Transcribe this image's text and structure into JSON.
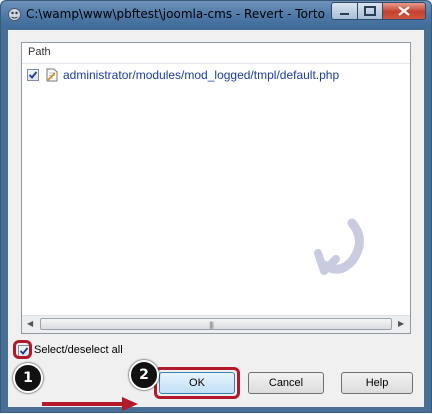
{
  "window": {
    "title": "C:\\wamp\\www\\pbftest\\joomla-cms - Revert - TortoiseSVN"
  },
  "list": {
    "column_header": "Path",
    "rows": [
      {
        "checked": true,
        "path": "administrator/modules/mod_logged/tmpl/default.php",
        "icon": "modified-file-icon"
      }
    ]
  },
  "select_all": {
    "label": "Select/deselect all",
    "checked": true
  },
  "buttons": {
    "ok": "OK",
    "cancel": "Cancel",
    "help": "Help"
  },
  "annotations": {
    "marker_1": "1",
    "marker_2": "2",
    "highlight_color": "#b21a2b"
  },
  "colors": {
    "path_text": "#1a3e9a",
    "titlebar": "#4f79a8"
  }
}
